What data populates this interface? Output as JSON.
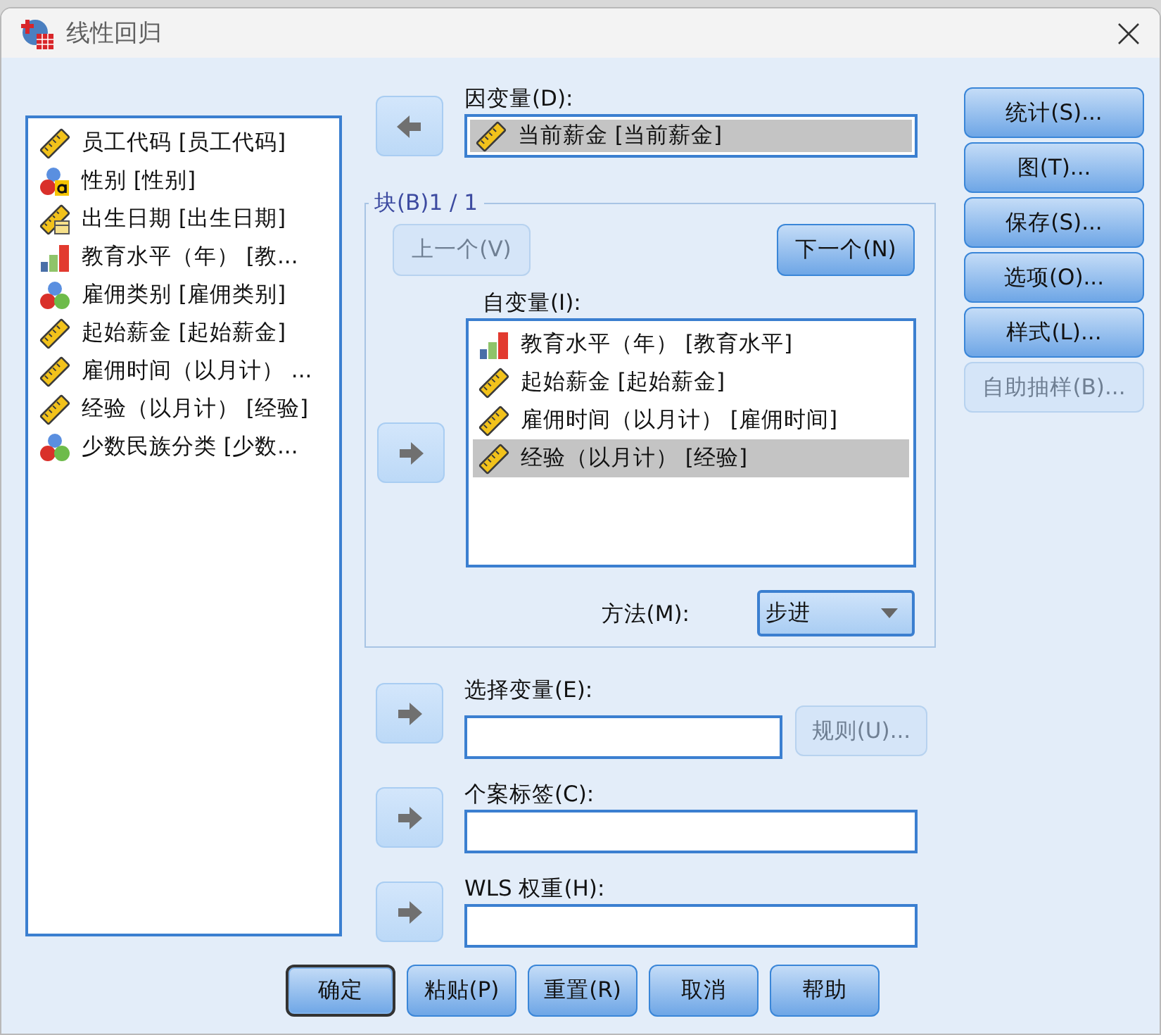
{
  "window": {
    "title": "线性回归"
  },
  "variables": [
    {
      "label": "员工代码 [员工代码]",
      "kind": "scale"
    },
    {
      "label": "性别 [性别]",
      "kind": "string_nominal"
    },
    {
      "label": "出生日期 [出生日期]",
      "kind": "date"
    },
    {
      "label": "教育水平（年） [教...",
      "kind": "ordinal"
    },
    {
      "label": "雇佣类别 [雇佣类别]",
      "kind": "nominal"
    },
    {
      "label": "起始薪金 [起始薪金]",
      "kind": "scale"
    },
    {
      "label": "雇佣时间（以月计） ...",
      "kind": "scale"
    },
    {
      "label": "经验（以月计） [经验]",
      "kind": "scale"
    },
    {
      "label": "少数民族分类 [少数...",
      "kind": "nominal"
    }
  ],
  "dependent": {
    "label": "因变量(D):",
    "arrow_points_left": true,
    "item": {
      "label": "当前薪金 [当前薪金]",
      "kind": "scale",
      "selected": true
    }
  },
  "block": {
    "title": "块(B)1 / 1",
    "buttons": [
      {
        "label": "上一个(V)",
        "disabled": true
      },
      {
        "label": "下一个(N)",
        "disabled": false
      }
    ],
    "independents": {
      "label": "自变量(I):",
      "arrow_points_left": false,
      "items": [
        {
          "label": "教育水平（年） [教育水平]",
          "kind": "ordinal",
          "selected": false
        },
        {
          "label": "起始薪金 [起始薪金]",
          "kind": "scale",
          "selected": false
        },
        {
          "label": "雇佣时间（以月计） [雇佣时间]",
          "kind": "scale",
          "selected": false
        },
        {
          "label": "经验（以月计） [经验]",
          "kind": "scale",
          "selected": true
        }
      ]
    },
    "method": {
      "label": "方法(M):",
      "value": "步进"
    }
  },
  "selection": {
    "label": "选择变量(E):",
    "arrow_points_left": false,
    "rule_button": {
      "label": "规则(U)...",
      "disabled": true
    }
  },
  "case_labels": {
    "label": "个案标签(C):",
    "arrow_points_left": false
  },
  "wls_weight": {
    "label": "WLS 权重(H):",
    "arrow_points_left": false
  },
  "side_buttons": [
    {
      "label": "统计(S)...",
      "disabled": false
    },
    {
      "label": "图(T)...",
      "disabled": false
    },
    {
      "label": "保存(S)...",
      "disabled": false
    },
    {
      "label": "选项(O)...",
      "disabled": false
    },
    {
      "label": "样式(L)...",
      "disabled": false
    },
    {
      "label": "自助抽样(B)...",
      "disabled": true
    }
  ],
  "buttons": [
    {
      "label": "确定",
      "default": true
    },
    {
      "label": "粘贴(P)",
      "default": false
    },
    {
      "label": "重置(R)",
      "default": false
    },
    {
      "label": "取消",
      "default": false
    },
    {
      "label": "帮助",
      "default": false
    }
  ]
}
